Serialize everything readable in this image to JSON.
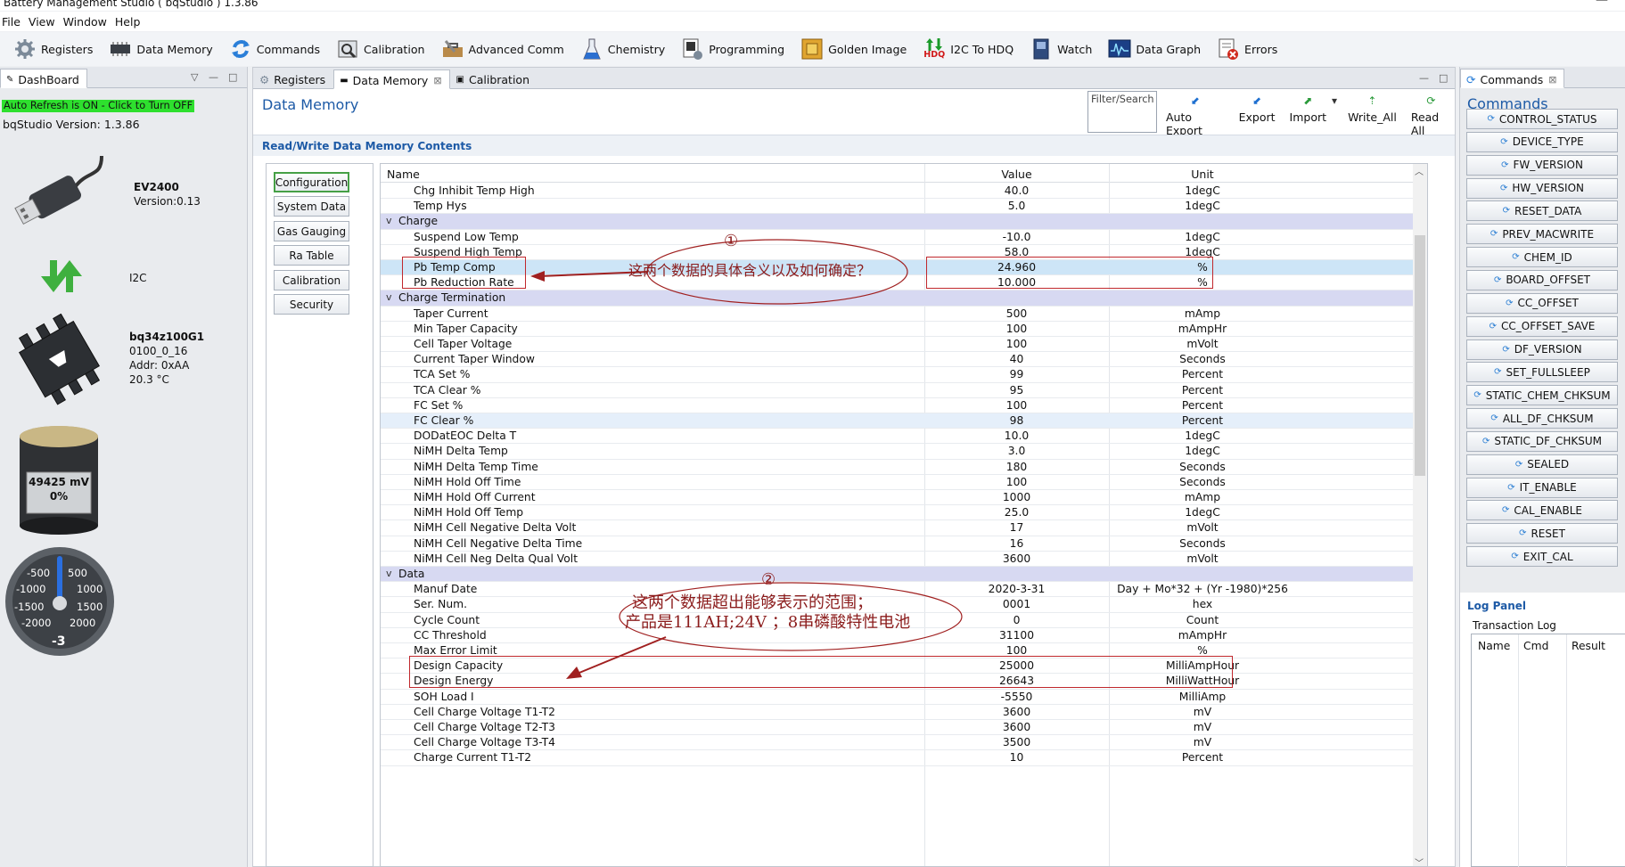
{
  "window": {
    "title": "Battery Management Studio ( bqStudio ) 1.3.86",
    "min_glyph": "—"
  },
  "menu": [
    "File",
    "View",
    "Window",
    "Help"
  ],
  "toolbar": [
    {
      "label": "Registers",
      "icon": "gear-icon"
    },
    {
      "label": "Data Memory",
      "icon": "chip-icon"
    },
    {
      "label": "Commands",
      "icon": "refresh-arrows-icon"
    },
    {
      "label": "Calibration",
      "icon": "measure-icon"
    },
    {
      "label": "Advanced Comm",
      "icon": "toolbox-icon"
    },
    {
      "label": "Chemistry",
      "icon": "flask-icon"
    },
    {
      "label": "Programming",
      "icon": "programming-icon"
    },
    {
      "label": "Golden Image",
      "icon": "golden-chip-icon"
    },
    {
      "label": "I2C To HDQ",
      "icon": "hdq-icon",
      "sub": "HDQ"
    },
    {
      "label": "Watch",
      "icon": "watch-icon"
    },
    {
      "label": "Data Graph",
      "icon": "graph-icon"
    },
    {
      "label": "Errors",
      "icon": "errors-icon"
    }
  ],
  "dashboard": {
    "tab": "DashBoard",
    "min_glyph": "—",
    "max_glyph": "□",
    "dropdown_glyph": "▽",
    "auto_refresh": "Auto Refresh is ON - Click to Turn OFF",
    "version_label": "bqStudio Version:",
    "version": "1.3.86",
    "ev_name": "EV2400",
    "ev_version": "Version:0.13",
    "bus": "I2C",
    "chip": "bq34z100G1",
    "chip_rev": "0100_0_16",
    "addr": "Addr: 0xAA",
    "temp": "20.3 °C",
    "battery_mv": "49425 mV",
    "battery_pct": "0%",
    "gauge_labels": [
      "-500",
      "500",
      "-1000",
      "1000",
      "-1500",
      "1500",
      "-2000",
      "2000"
    ],
    "gauge_value": "-3"
  },
  "center": {
    "tabs": [
      {
        "label": "Registers"
      },
      {
        "label": "Data Memory",
        "close": "⊠"
      },
      {
        "label": "Calibration"
      }
    ],
    "min_glyph": "—",
    "max_glyph": "□",
    "title": "Data Memory",
    "filter_placeholder": "Filter/Search",
    "actions": [
      "Auto Export",
      "Export",
      "Import",
      "Write_All",
      "Read All"
    ],
    "import_dropdown": "▾",
    "subheader": "Read/Write Data Memory Contents",
    "categories": [
      "Configuration",
      "System Data",
      "Gas Gauging",
      "Ra Table",
      "Calibration",
      "Security"
    ],
    "selected_category": "Configuration",
    "columns": [
      "Name",
      "Value",
      "Unit"
    ],
    "expand_glyph": "v",
    "scroll_up": "︿",
    "scroll_down": "﹀",
    "rows": [
      {
        "n": "Chg Inhibit Temp High",
        "v": "40.0",
        "u": "1degC"
      },
      {
        "n": "Temp Hys",
        "v": "5.0",
        "u": "1degC"
      },
      {
        "g": "Charge"
      },
      {
        "n": "Suspend Low Temp",
        "v": "-10.0",
        "u": "1degC"
      },
      {
        "n": "Suspend High Temp",
        "v": "58.0",
        "u": "1degC"
      },
      {
        "n": "Pb Temp Comp",
        "v": "24.960",
        "u": "%",
        "s": "sel"
      },
      {
        "n": "Pb Reduction Rate",
        "v": "10.000",
        "u": "%"
      },
      {
        "g": "Charge Termination"
      },
      {
        "n": "Taper Current",
        "v": "500",
        "u": "mAmp"
      },
      {
        "n": "Min Taper Capacity",
        "v": "100",
        "u": "mAmpHr"
      },
      {
        "n": "Cell Taper Voltage",
        "v": "100",
        "u": "mVolt"
      },
      {
        "n": "Current Taper Window",
        "v": "40",
        "u": "Seconds"
      },
      {
        "n": "TCA Set %",
        "v": "99",
        "u": "Percent"
      },
      {
        "n": "TCA Clear %",
        "v": "95",
        "u": "Percent"
      },
      {
        "n": "FC Set %",
        "v": "100",
        "u": "Percent"
      },
      {
        "n": "FC Clear %",
        "v": "98",
        "u": "Percent",
        "s": "hl"
      },
      {
        "n": "DODatEOC Delta T",
        "v": "10.0",
        "u": "1degC"
      },
      {
        "n": "NiMH Delta Temp",
        "v": "3.0",
        "u": "1degC"
      },
      {
        "n": "NiMH Delta Temp Time",
        "v": "180",
        "u": "Seconds"
      },
      {
        "n": "NiMH Hold Off  Time",
        "v": "100",
        "u": "Seconds"
      },
      {
        "n": "NiMH Hold Off Current",
        "v": "1000",
        "u": "mAmp"
      },
      {
        "n": "NiMH Hold Off  Temp",
        "v": "25.0",
        "u": "1degC"
      },
      {
        "n": "NiMH Cell Negative Delta Volt",
        "v": "17",
        "u": "mVolt"
      },
      {
        "n": "NiMH Cell Negative Delta Time",
        "v": "16",
        "u": "Seconds"
      },
      {
        "n": "NiMH Cell Neg Delta Qual Volt",
        "v": "3600",
        "u": "mVolt"
      },
      {
        "g": "Data"
      },
      {
        "n": "Manuf  Date",
        "v": "2020-3-31",
        "u": "Day + Mo*32 + (Yr -1980)*256"
      },
      {
        "n": "Ser. Num.",
        "v": "0001",
        "u": "hex"
      },
      {
        "n": "Cycle Count",
        "v": "0",
        "u": "Count"
      },
      {
        "n": "CC Threshold",
        "v": "31100",
        "u": "mAmpHr"
      },
      {
        "n": "Max Error Limit",
        "v": "100",
        "u": "%"
      },
      {
        "n": "Design Capacity",
        "v": "25000",
        "u": "MilliAmpHour"
      },
      {
        "n": "Design Energy",
        "v": "26643",
        "u": "MilliWattHour"
      },
      {
        "n": "SOH Load I",
        "v": "-5550",
        "u": "MilliAmp"
      },
      {
        "n": "Cell Charge Voltage T1-T2",
        "v": "3600",
        "u": "mV"
      },
      {
        "n": "Cell Charge Voltage T2-T3",
        "v": "3600",
        "u": "mV"
      },
      {
        "n": "Cell Charge Voltage T3-T4",
        "v": "3500",
        "u": "mV"
      },
      {
        "n": "Charge Current T1-T2",
        "v": "10",
        "u": "Percent"
      }
    ],
    "annotation1": {
      "num": "①",
      "text": "这两个数据的具体含义以及如何确定？"
    },
    "annotation2": {
      "num": "②",
      "line1": "这两个数据超出能够表示的范围；",
      "line2": "产品是111AH;24V ；8串磷酸特性电池"
    }
  },
  "commands": {
    "tab": "Commands",
    "close": "⊠",
    "title": "Commands",
    "button_glyph": "⟳",
    "buttons": [
      "CONTROL_STATUS",
      "DEVICE_TYPE",
      "FW_VERSION",
      "HW_VERSION",
      "RESET_DATA",
      "PREV_MACWRITE",
      "CHEM_ID",
      "BOARD_OFFSET",
      "CC_OFFSET",
      "CC_OFFSET_SAVE",
      "DF_VERSION",
      "SET_FULLSLEEP",
      "STATIC_CHEM_CHKSUM",
      "ALL_DF_CHKSUM",
      "STATIC_DF_CHKSUM",
      "SEALED",
      "IT_ENABLE",
      "CAL_ENABLE",
      "RESET",
      "EXIT_CAL"
    ]
  },
  "log": {
    "title": "Log Panel",
    "subtitle": "Transaction Log",
    "columns": [
      "Name",
      "Cmd",
      "Result"
    ]
  }
}
